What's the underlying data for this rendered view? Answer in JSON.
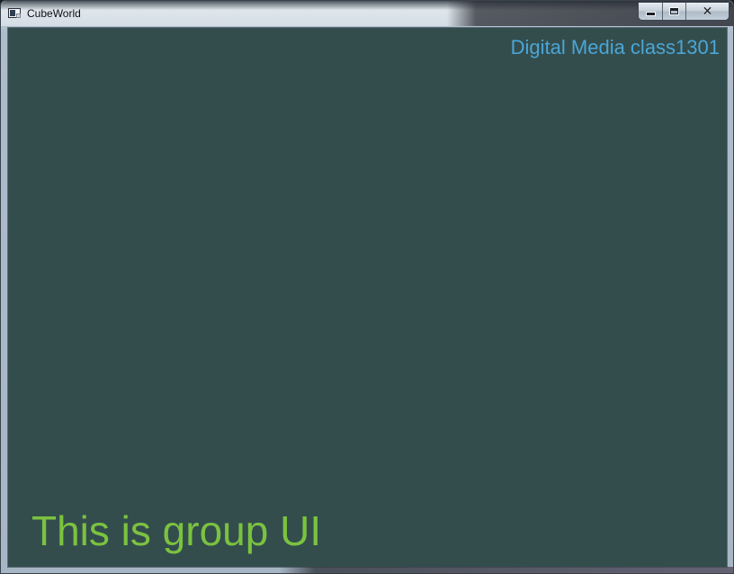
{
  "window": {
    "title": "CubeWorld",
    "icon": "app-window-icon",
    "controls": {
      "minimize_icon": "minimize-icon",
      "maximize_icon": "maximize-icon",
      "close_icon": "close-icon",
      "close_glyph": "✕"
    }
  },
  "scene": {
    "background_color": "#334d4d",
    "top_right_text": "Digital Media class1301",
    "top_right_color": "#4ba6d6",
    "bottom_left_text": "This is group UI",
    "bottom_left_color": "#7bc23f"
  }
}
